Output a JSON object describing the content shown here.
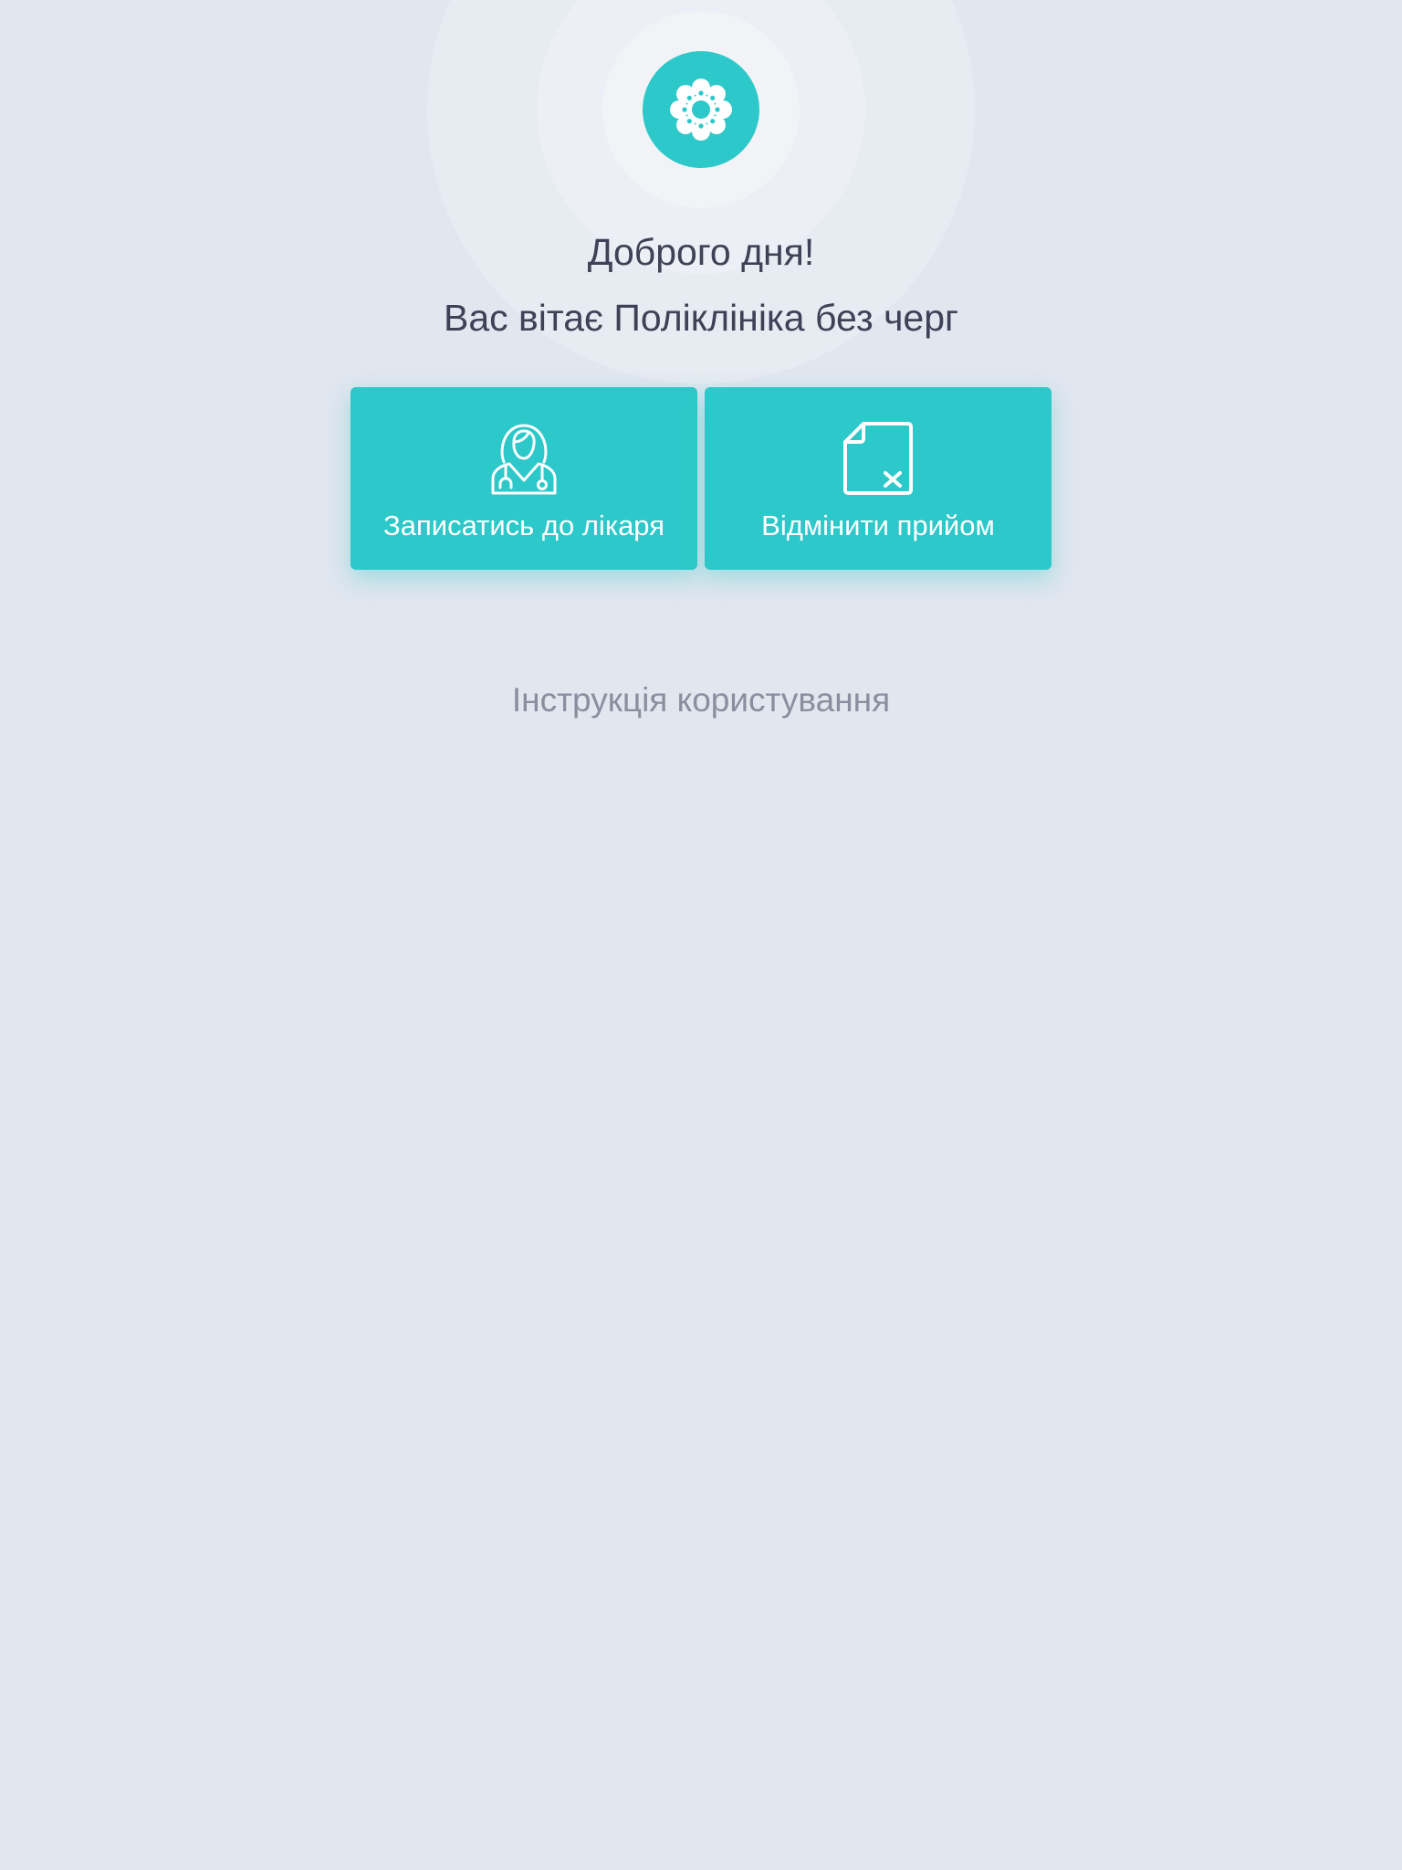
{
  "header": {
    "logo_icon": "flower-icon",
    "greeting": "Доброго дня!",
    "subtitle": "Вас вітає Поліклініка без черг"
  },
  "actions": [
    {
      "icon": "doctor-icon",
      "label": "Записатись до лікаря"
    },
    {
      "icon": "cancel-document-icon",
      "label": "Відмінити прийом"
    }
  ],
  "footer": {
    "instructions_link": "Інструкція користування"
  },
  "colors": {
    "background": "#e1e6ef",
    "accent": "#2dc8c9",
    "title_text": "#3d4257",
    "link_text": "#8a8e9e"
  }
}
